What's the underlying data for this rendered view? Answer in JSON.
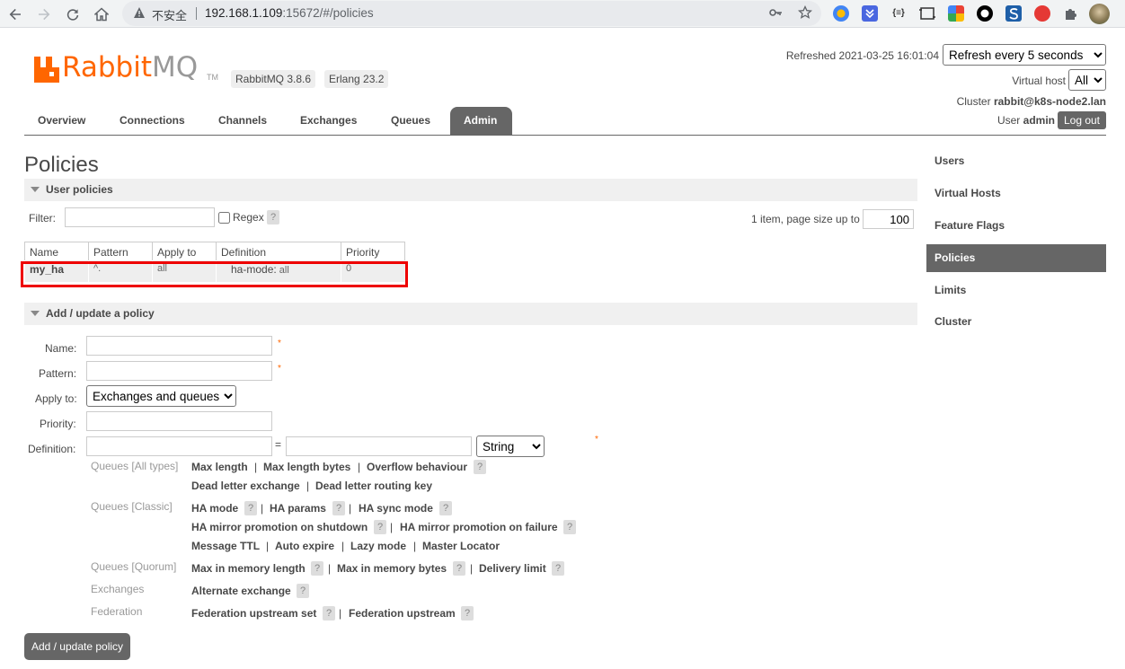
{
  "browser": {
    "insecure_label": "不安全",
    "url_host": "192.168.1.109",
    "url_rest": ":15672/#/policies"
  },
  "header": {
    "logo_r": "Rabbit",
    "logo_mq": "MQ",
    "logo_tm": "TM",
    "rabbitmq_version": "RabbitMQ 3.8.6",
    "erlang_version": "Erlang 23.2",
    "refreshed_label": "Refreshed 2021-03-25 16:01:04",
    "refresh_select": "Refresh every 5 seconds",
    "virtual_host_label": "Virtual host",
    "virtual_host_value": "All",
    "cluster_label": "Cluster",
    "cluster_value": "rabbit@k8s-node2.lan",
    "user_label": "User",
    "user_value": "admin",
    "logout": "Log out"
  },
  "tabs": [
    {
      "label": "Overview"
    },
    {
      "label": "Connections"
    },
    {
      "label": "Channels"
    },
    {
      "label": "Exchanges"
    },
    {
      "label": "Queues"
    },
    {
      "label": "Admin",
      "active": true
    }
  ],
  "page_title": "Policies",
  "user_policies": {
    "section_label": "User policies",
    "filter_label": "Filter:",
    "regex_label": "Regex",
    "help": "?",
    "pagination_text": "1 item, page size up to",
    "page_size": "100",
    "columns": [
      "Name",
      "Pattern",
      "Apply to",
      "Definition",
      "Priority"
    ],
    "rows": [
      {
        "name": "my_ha",
        "pattern": "^.",
        "apply_to": "all",
        "def_key": "ha-mode:",
        "def_value": "all",
        "priority": "0"
      }
    ]
  },
  "add_policy": {
    "section_label": "Add / update a policy",
    "name_label": "Name:",
    "pattern_label": "Pattern:",
    "apply_to_label": "Apply to:",
    "apply_to_value": "Exchanges and queues",
    "priority_label": "Priority:",
    "definition_label": "Definition:",
    "equals": "=",
    "type_value": "String",
    "required_mark": "*",
    "categories": {
      "queues_all": "Queues [All types]",
      "queues_classic": "Queues [Classic]",
      "queues_quorum": "Queues [Quorum]",
      "exchanges": "Exchanges",
      "federation": "Federation"
    },
    "options": {
      "max_length": "Max length",
      "max_length_bytes": "Max length bytes",
      "overflow_behaviour": "Overflow behaviour",
      "dead_letter_exchange": "Dead letter exchange",
      "dead_letter_routing_key": "Dead letter routing key",
      "ha_mode": "HA mode",
      "ha_params": "HA params",
      "ha_sync_mode": "HA sync mode",
      "ha_promo_shutdown": "HA mirror promotion on shutdown",
      "ha_promo_failure": "HA mirror promotion on failure",
      "message_ttl": "Message TTL",
      "auto_expire": "Auto expire",
      "lazy_mode": "Lazy mode",
      "master_locator": "Master Locator",
      "max_in_memory_length": "Max in memory length",
      "max_in_memory_bytes": "Max in memory bytes",
      "delivery_limit": "Delivery limit",
      "alternate_exchange": "Alternate exchange",
      "federation_upstream_set": "Federation upstream set",
      "federation_upstream": "Federation upstream"
    },
    "separator": "|",
    "submit": "Add / update policy"
  },
  "sidebar": {
    "items": [
      {
        "label": "Users"
      },
      {
        "label": "Virtual Hosts"
      },
      {
        "label": "Feature Flags"
      },
      {
        "label": "Policies",
        "active": true
      },
      {
        "label": "Limits"
      },
      {
        "label": "Cluster"
      }
    ]
  },
  "colors": {
    "brand_orange": "#ff6600",
    "active_tab": "#666666",
    "highlight_border": "#ee0000"
  }
}
